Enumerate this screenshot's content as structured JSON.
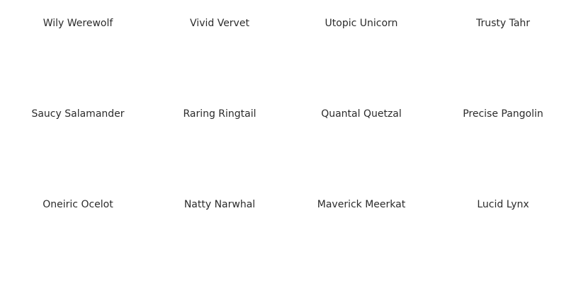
{
  "releases": [
    {
      "name": "Wily Werewolf"
    },
    {
      "name": "Vivid Vervet"
    },
    {
      "name": "Utopic Unicorn"
    },
    {
      "name": "Trusty Tahr"
    },
    {
      "name": "Saucy Salamander"
    },
    {
      "name": "Raring Ringtail"
    },
    {
      "name": "Quantal Quetzal"
    },
    {
      "name": "Precise Pangolin"
    },
    {
      "name": "Oneiric Ocelot"
    },
    {
      "name": "Natty Narwhal"
    },
    {
      "name": "Maverick Meerkat"
    },
    {
      "name": "Lucid Lynx"
    }
  ]
}
